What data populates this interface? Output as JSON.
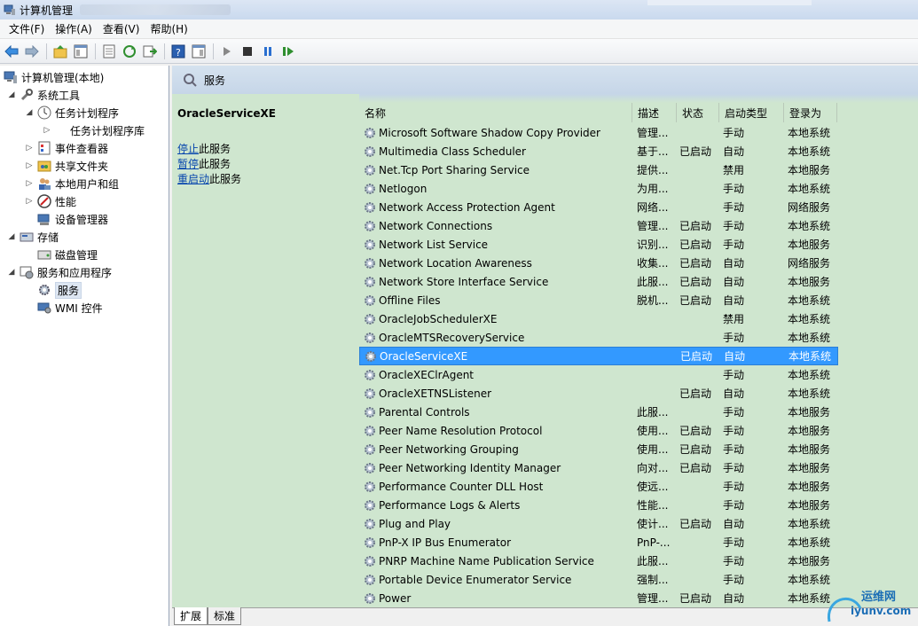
{
  "window": {
    "title": "计算机管理"
  },
  "menubar": [
    "文件(F)",
    "操作(A)",
    "查看(V)",
    "帮助(H)"
  ],
  "tree": [
    {
      "label": "计算机管理(本地)",
      "icon": "computer-icon"
    },
    {
      "label": "系统工具",
      "icon": "tools-icon"
    },
    {
      "label": "任务计划程序",
      "icon": "clock-icon"
    },
    {
      "label": "任务计划程序库",
      "icon": "none"
    },
    {
      "label": "事件查看器",
      "icon": "event-viewer-icon"
    },
    {
      "label": "共享文件夹",
      "icon": "shared-folder-icon"
    },
    {
      "label": "本地用户和组",
      "icon": "users-icon"
    },
    {
      "label": "性能",
      "icon": "performance-icon"
    },
    {
      "label": "设备管理器",
      "icon": "device-manager-icon"
    },
    {
      "label": "存储",
      "icon": "storage-icon"
    },
    {
      "label": "磁盘管理",
      "icon": "disk-icon"
    },
    {
      "label": "服务和应用程序",
      "icon": "services-apps-icon"
    },
    {
      "label": "服务",
      "icon": "gear-icon"
    },
    {
      "label": "WMI 控件",
      "icon": "wmi-icon"
    }
  ],
  "header": {
    "title": "服务"
  },
  "details": {
    "service_name": "OracleServiceXE",
    "actions": [
      {
        "link": "停止",
        "rest": "此服务"
      },
      {
        "link": "暂停",
        "rest": "此服务"
      },
      {
        "link": "重启动",
        "rest": "此服务"
      }
    ]
  },
  "columns": [
    "名称",
    "描述",
    "状态",
    "启动类型",
    "登录为"
  ],
  "services": [
    {
      "name": "Microsoft Software Shadow Copy Provider",
      "desc": "管理...",
      "state": "",
      "startup": "手动",
      "logon": "本地系统"
    },
    {
      "name": "Multimedia Class Scheduler",
      "desc": "基于...",
      "state": "已启动",
      "startup": "自动",
      "logon": "本地系统"
    },
    {
      "name": "Net.Tcp Port Sharing Service",
      "desc": "提供...",
      "state": "",
      "startup": "禁用",
      "logon": "本地服务"
    },
    {
      "name": "Netlogon",
      "desc": "为用...",
      "state": "",
      "startup": "手动",
      "logon": "本地系统"
    },
    {
      "name": "Network Access Protection Agent",
      "desc": "网络...",
      "state": "",
      "startup": "手动",
      "logon": "网络服务"
    },
    {
      "name": "Network Connections",
      "desc": "管理...",
      "state": "已启动",
      "startup": "手动",
      "logon": "本地系统"
    },
    {
      "name": "Network List Service",
      "desc": "识别...",
      "state": "已启动",
      "startup": "手动",
      "logon": "本地服务"
    },
    {
      "name": "Network Location Awareness",
      "desc": "收集...",
      "state": "已启动",
      "startup": "自动",
      "logon": "网络服务"
    },
    {
      "name": "Network Store Interface Service",
      "desc": "此服...",
      "state": "已启动",
      "startup": "自动",
      "logon": "本地服务"
    },
    {
      "name": "Offline Files",
      "desc": "脱机...",
      "state": "已启动",
      "startup": "自动",
      "logon": "本地系统"
    },
    {
      "name": "OracleJobSchedulerXE",
      "desc": "",
      "state": "",
      "startup": "禁用",
      "logon": "本地系统"
    },
    {
      "name": "OracleMTSRecoveryService",
      "desc": "",
      "state": "",
      "startup": "手动",
      "logon": "本地系统"
    },
    {
      "name": "OracleServiceXE",
      "desc": "",
      "state": "已启动",
      "startup": "自动",
      "logon": "本地系统"
    },
    {
      "name": "OracleXEClrAgent",
      "desc": "",
      "state": "",
      "startup": "手动",
      "logon": "本地系统"
    },
    {
      "name": "OracleXETNSListener",
      "desc": "",
      "state": "已启动",
      "startup": "自动",
      "logon": "本地系统"
    },
    {
      "name": "Parental Controls",
      "desc": "此服...",
      "state": "",
      "startup": "手动",
      "logon": "本地服务"
    },
    {
      "name": "Peer Name Resolution Protocol",
      "desc": "使用...",
      "state": "已启动",
      "startup": "手动",
      "logon": "本地服务"
    },
    {
      "name": "Peer Networking Grouping",
      "desc": "使用...",
      "state": "已启动",
      "startup": "手动",
      "logon": "本地服务"
    },
    {
      "name": "Peer Networking Identity Manager",
      "desc": "向对...",
      "state": "已启动",
      "startup": "手动",
      "logon": "本地服务"
    },
    {
      "name": "Performance Counter DLL Host",
      "desc": "使远...",
      "state": "",
      "startup": "手动",
      "logon": "本地服务"
    },
    {
      "name": "Performance Logs & Alerts",
      "desc": "性能...",
      "state": "",
      "startup": "手动",
      "logon": "本地服务"
    },
    {
      "name": "Plug and Play",
      "desc": "使计...",
      "state": "已启动",
      "startup": "自动",
      "logon": "本地系统"
    },
    {
      "name": "PnP-X IP Bus Enumerator",
      "desc": "PnP-...",
      "state": "",
      "startup": "手动",
      "logon": "本地系统"
    },
    {
      "name": "PNRP Machine Name Publication Service",
      "desc": "此服...",
      "state": "",
      "startup": "手动",
      "logon": "本地服务"
    },
    {
      "name": "Portable Device Enumerator Service",
      "desc": "强制...",
      "state": "",
      "startup": "手动",
      "logon": "本地系统"
    },
    {
      "name": "Power",
      "desc": "管理...",
      "state": "已启动",
      "startup": "自动",
      "logon": "本地系统"
    }
  ],
  "selected_service": "OracleServiceXE",
  "tabs": [
    "扩展",
    "标准"
  ],
  "watermark": {
    "cn": "运维网",
    "en": "iyunv.com"
  }
}
